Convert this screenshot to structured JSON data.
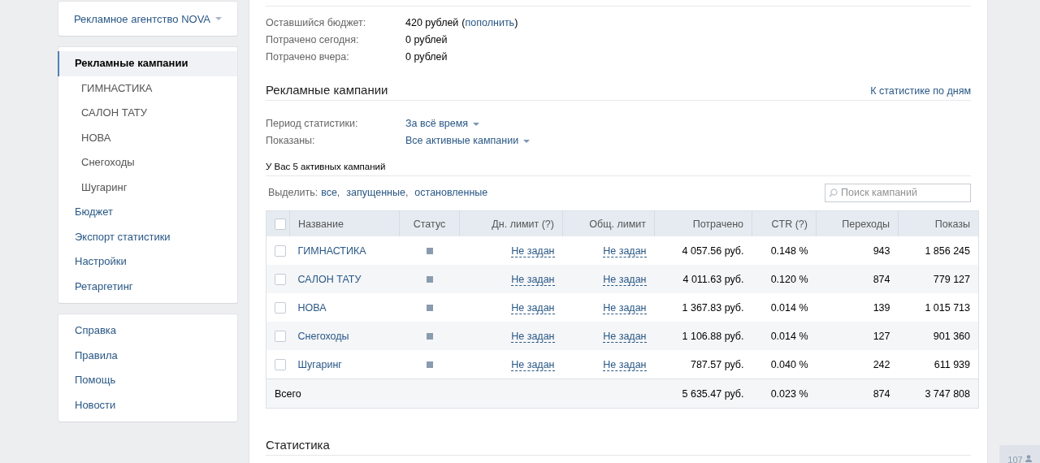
{
  "account_menu": {
    "label": "Рекламное агентство NOVA"
  },
  "sidebar": {
    "items": [
      {
        "label": "Рекламные кампании",
        "selected": true,
        "children": [
          {
            "label": "ГИМНАСТИКА"
          },
          {
            "label": "САЛОН ТАТУ"
          },
          {
            "label": "НОВА"
          },
          {
            "label": "Снегоходы"
          },
          {
            "label": "Шугаринг"
          }
        ]
      },
      {
        "label": "Бюджет",
        "selected": false
      },
      {
        "label": "Экспорт статистики",
        "selected": false
      },
      {
        "label": "Настройки",
        "selected": false
      },
      {
        "label": "Ретаргетинг",
        "selected": false
      }
    ]
  },
  "help_links": [
    "Справка",
    "Правила",
    "Помощь",
    "Новости"
  ],
  "budget": [
    {
      "label": "Оставшийся бюджет:",
      "value": "420 рублей",
      "link_open": "(",
      "link": "пополнить",
      "link_close": ")"
    },
    {
      "label": "Потрачено сегодня:",
      "value": "0 рублей"
    },
    {
      "label": "Потрачено вчера:",
      "value": "0 рублей"
    }
  ],
  "campaigns_section": {
    "title": "Рекламные кампании",
    "stats_link": "К статистике по дням",
    "filters": [
      {
        "label": "Период статистики:",
        "value": "За всё время"
      },
      {
        "label": "Показаны:",
        "value": "Все активные кампании"
      }
    ],
    "summary": "У Вас 5 активных кампаний",
    "select_label": "Выделить:",
    "select_links": [
      {
        "label": "все",
        "separator": ","
      },
      {
        "label": "запущенные",
        "separator": ","
      },
      {
        "label": "остановленные"
      }
    ],
    "search": {
      "placeholder": "Поиск кампаний"
    },
    "table": {
      "columns": [
        "Название",
        "Статус",
        "Дн. лимит (?)",
        "Общ. лимит",
        "Потрачено",
        "CTR (?)",
        "Переходы",
        "Показы"
      ],
      "header_checked": false,
      "rows": [
        {
          "checked": false,
          "name": "ГИМНАСТИКА",
          "status": {
            "color": "#8a9bb0"
          },
          "daily_limit": "Не задан",
          "total_limit": "Не задан",
          "spent": "4 057.56 руб.",
          "ctr": "0.148 %",
          "clicks": "943",
          "impressions": "1 856 245"
        },
        {
          "checked": false,
          "name": "САЛОН ТАТУ",
          "status": {
            "color": "#8a9bb0"
          },
          "daily_limit": "Не задан",
          "total_limit": "Не задан",
          "spent": "4 011.63 руб.",
          "ctr": "0.120 %",
          "clicks": "874",
          "impressions": "779 127"
        },
        {
          "checked": false,
          "name": "НОВА",
          "status": {
            "color": "#8a9bb0"
          },
          "daily_limit": "Не задан",
          "total_limit": "Не задан",
          "spent": "1 367.83 руб.",
          "ctr": "0.014 %",
          "clicks": "139",
          "impressions": "1 015 713"
        },
        {
          "checked": false,
          "name": "Снегоходы",
          "status": {
            "color": "#8a9bb0"
          },
          "daily_limit": "Не задан",
          "total_limit": "Не задан",
          "spent": "1 106.88 руб.",
          "ctr": "0.014 %",
          "clicks": "127",
          "impressions": "901 360"
        },
        {
          "checked": false,
          "name": "Шугаринг",
          "status": {
            "color": "#8a9bb0"
          },
          "daily_limit": "Не задан",
          "total_limit": "Не задан",
          "spent": "787.57 руб.",
          "ctr": "0.040 %",
          "clicks": "242",
          "impressions": "611 939"
        }
      ],
      "total": {
        "label": "Всего",
        "spent": "5 635.47 руб.",
        "ctr": "0.023 %",
        "clicks": "874",
        "impressions": "3 747 808"
      }
    }
  },
  "statistics_section": {
    "title": "Статистика"
  },
  "online_badge": {
    "count": "107"
  }
}
